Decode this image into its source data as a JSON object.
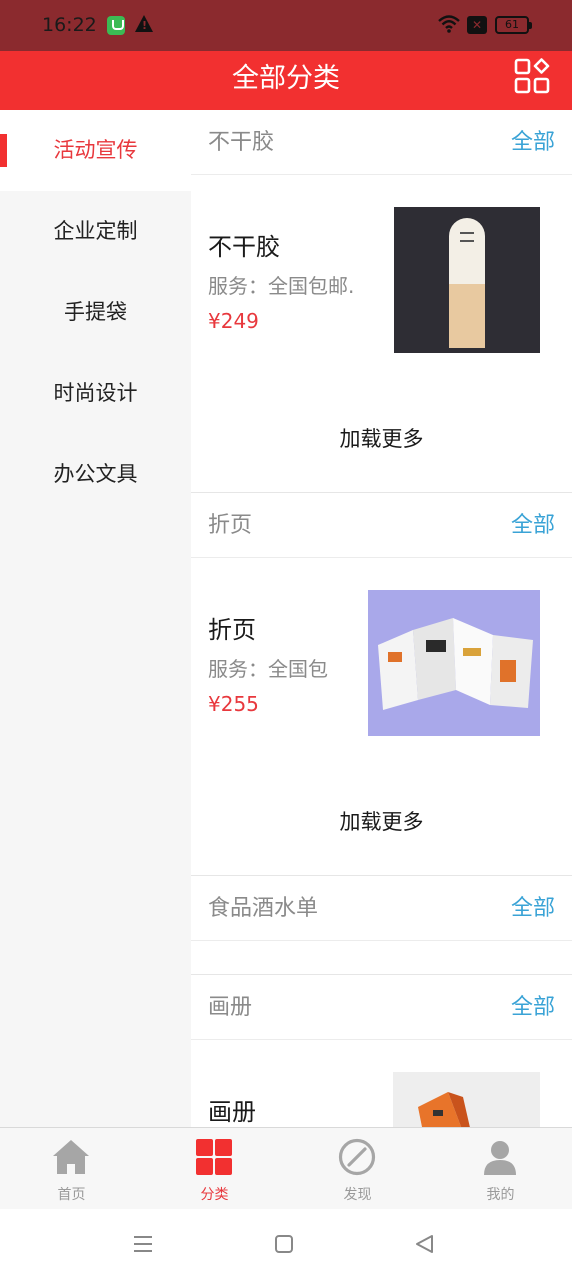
{
  "status_bar": {
    "time": "16:22",
    "battery": "61",
    "icons": [
      "app-notification-icon",
      "warning-icon",
      "wifi-icon",
      "signal-off-icon",
      "battery-icon"
    ]
  },
  "header": {
    "title": "全部分类",
    "right_icon": "category-grid-icon"
  },
  "sidebar": {
    "items": [
      {
        "label": "活动宣传",
        "active": true
      },
      {
        "label": "企业定制",
        "active": false
      },
      {
        "label": "手提袋",
        "active": false
      },
      {
        "label": "时尚设计",
        "active": false
      },
      {
        "label": "办公文具",
        "active": false
      }
    ]
  },
  "sections": [
    {
      "title": "不干胶",
      "all_label": "全部",
      "product": {
        "name": "不干胶",
        "service": "服务：全国包邮.",
        "price": "¥249"
      },
      "load_more": "加载更多"
    },
    {
      "title": "折页",
      "all_label": "全部",
      "product": {
        "name": "折页",
        "service": "服务：全国包",
        "price": "¥255"
      },
      "load_more": "加载更多"
    },
    {
      "title": "食品酒水单",
      "all_label": "全部"
    },
    {
      "title": "画册",
      "all_label": "全部",
      "product": {
        "name": "画册"
      }
    }
  ],
  "tabbar": {
    "tabs": [
      {
        "label": "首页",
        "icon": "home-icon",
        "active": false
      },
      {
        "label": "分类",
        "icon": "category-icon",
        "active": true
      },
      {
        "label": "发现",
        "icon": "discover-icon",
        "active": false
      },
      {
        "label": "我的",
        "icon": "profile-icon",
        "active": false
      }
    ]
  },
  "colors": {
    "brand_red": "#f23030",
    "status_bar": "#8b2a2e",
    "link_blue": "#3aa3d6",
    "price_red": "#e8383d"
  }
}
